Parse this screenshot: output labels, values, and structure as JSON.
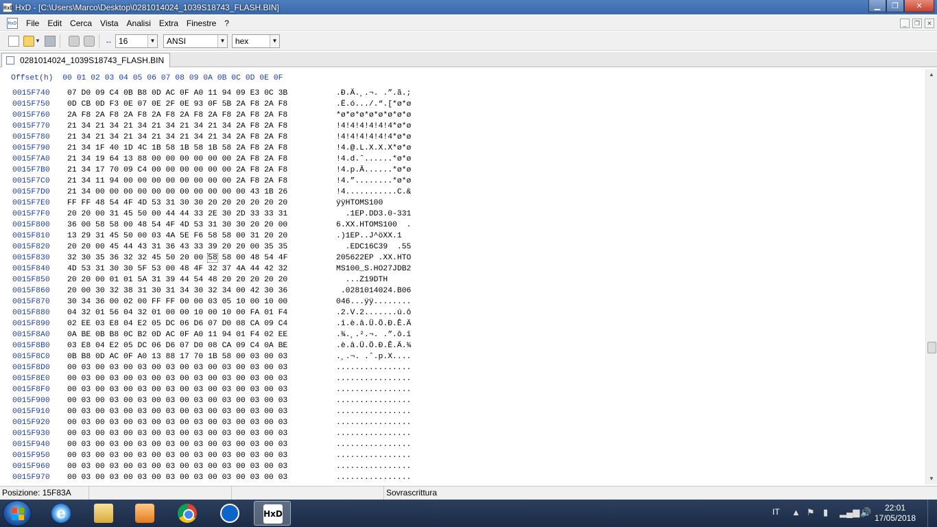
{
  "window": {
    "title": "HxD - [C:\\Users\\Marco\\Desktop\\0281014024_1039S18743_FLASH.BIN]",
    "app_icon_text": "HxD"
  },
  "window_controls": {
    "minimize": "▁",
    "maximize": "❐",
    "close": "✕"
  },
  "menu": [
    "File",
    "Edit",
    "Cerca",
    "Vista",
    "Analisi",
    "Extra",
    "Finestre",
    "?"
  ],
  "toolbar": {
    "bytes_per_row": "16",
    "charset": "ANSI",
    "offset_base": "hex"
  },
  "tab": {
    "label": "0281014024_1039S18743_FLASH.BIN"
  },
  "editor": {
    "header": "Offset(h)  00 01 02 03 04 05 06 07 08 09 0A 0B 0C 0D 0E 0F",
    "rows": [
      {
        "off": "0015F740",
        "hex": "07 D0 09 C4 0B B8 0D AC 0F A0 11 94 09 E3 0C 3B",
        "asc": ".Ð.Ä.¸.¬. .”.ã.;"
      },
      {
        "off": "0015F750",
        "hex": "0D CB 0D F3 0E 07 0E 2F 0E 93 0F 5B 2A F8 2A F8",
        "asc": ".Ë.ó.../.“.[*ø*ø"
      },
      {
        "off": "0015F760",
        "hex": "2A F8 2A F8 2A F8 2A F8 2A F8 2A F8 2A F8 2A F8",
        "asc": "*ø*ø*ø*ø*ø*ø*ø*ø"
      },
      {
        "off": "0015F770",
        "hex": "21 34 21 34 21 34 21 34 21 34 21 34 2A F8 2A F8",
        "asc": "!4!4!4!4!4!4*ø*ø"
      },
      {
        "off": "0015F780",
        "hex": "21 34 21 34 21 34 21 34 21 34 21 34 2A F8 2A F8",
        "asc": "!4!4!4!4!4!4*ø*ø"
      },
      {
        "off": "0015F790",
        "hex": "21 34 1F 40 1D 4C 1B 58 1B 58 1B 58 2A F8 2A F8",
        "asc": "!4.@.L.X.X.X*ø*ø"
      },
      {
        "off": "0015F7A0",
        "hex": "21 34 19 64 13 88 00 00 00 00 00 00 2A F8 2A F8",
        "asc": "!4.d.ˆ......*ø*ø"
      },
      {
        "off": "0015F7B0",
        "hex": "21 34 17 70 09 C4 00 00 00 00 00 00 2A F8 2A F8",
        "asc": "!4.p.Ä......*ø*ø"
      },
      {
        "off": "0015F7C0",
        "hex": "21 34 11 94 00 00 00 00 00 00 00 00 2A F8 2A F8",
        "asc": "!4.”........*ø*ø"
      },
      {
        "off": "0015F7D0",
        "hex": "21 34 00 00 00 00 00 00 00 00 00 00 00 43 1B 26",
        "asc": "!4...........C.&"
      },
      {
        "off": "0015F7E0",
        "hex": "FF FF 48 54 4F 4D 53 31 30 30 20 20 20 20 20 20",
        "asc": "ÿÿHTOMS100      "
      },
      {
        "off": "0015F7F0",
        "hex": "20 20 00 31 45 50 00 44 44 33 2E 30 2D 33 33 31",
        "asc": "  .1EP.DD3.0-331"
      },
      {
        "off": "0015F800",
        "hex": "36 00 58 58 00 48 54 4F 4D 53 31 30 30 20 20 00",
        "asc": "6.XX.HTOMS100  ."
      },
      {
        "off": "0015F810",
        "hex": "13 29 31 45 50 00 03 4A 5E F6 58 58 00 31 20 20",
        "asc": ".)1EP..J^öXX.1  "
      },
      {
        "off": "0015F820",
        "hex": "20 20 00 45 44 43 31 36 43 33 39 20 20 00 35 35",
        "asc": "  .EDC16C39  .55"
      },
      {
        "off": "0015F830",
        "hex": "32 30 35 36 32 32 45 50 20 00 58 58 00 48 54 4F",
        "asc": "205622EP .XX.HTO"
      },
      {
        "off": "0015F840",
        "hex": "4D 53 31 30 30 5F 53 00 48 4F 32 37 4A 44 42 32",
        "asc": "MS100_S.HO27JDB2"
      },
      {
        "off": "0015F850",
        "hex": "20 20 00 01 01 5A 31 39 44 54 48 20 20 20 20 20",
        "asc": "  ...Z19DTH     "
      },
      {
        "off": "0015F860",
        "hex": "20 00 30 32 38 31 30 31 34 30 32 34 00 42 30 36",
        "asc": " .0281014024.B06"
      },
      {
        "off": "0015F870",
        "hex": "30 34 36 00 02 00 FF FF 00 00 03 05 10 00 10 00",
        "asc": "046...ÿÿ........"
      },
      {
        "off": "0015F880",
        "hex": "04 32 01 56 04 32 01 00 00 10 00 10 00 FA 01 F4",
        "asc": ".2.V.2.......ú.ô"
      },
      {
        "off": "0015F890",
        "hex": "02 EE 03 E8 04 E2 05 DC 06 D6 07 D0 08 CA 09 C4",
        "asc": ".î.è.â.Ü.Ö.Ð.Ê.Ä"
      },
      {
        "off": "0015F8A0",
        "hex": "0A BE 0B B8 0C B2 0D AC 0F A0 11 94 01 F4 02 EE",
        "asc": ".¾.¸.².¬. .”.ô.î"
      },
      {
        "off": "0015F8B0",
        "hex": "03 E8 04 E2 05 DC 06 D6 07 D0 08 CA 09 C4 0A BE",
        "asc": ".è.â.Ü.Ö.Ð.Ê.Ä.¾"
      },
      {
        "off": "0015F8C0",
        "hex": "0B B8 0D AC 0F A0 13 88 17 70 1B 58 00 03 00 03",
        "asc": ".¸.¬. .ˆ.p.X...."
      },
      {
        "off": "0015F8D0",
        "hex": "00 03 00 03 00 03 00 03 00 03 00 03 00 03 00 03",
        "asc": "................"
      },
      {
        "off": "0015F8E0",
        "hex": "00 03 00 03 00 03 00 03 00 03 00 03 00 03 00 03",
        "asc": "................"
      },
      {
        "off": "0015F8F0",
        "hex": "00 03 00 03 00 03 00 03 00 03 00 03 00 03 00 03",
        "asc": "................"
      },
      {
        "off": "0015F900",
        "hex": "00 03 00 03 00 03 00 03 00 03 00 03 00 03 00 03",
        "asc": "................"
      },
      {
        "off": "0015F910",
        "hex": "00 03 00 03 00 03 00 03 00 03 00 03 00 03 00 03",
        "asc": "................"
      },
      {
        "off": "0015F920",
        "hex": "00 03 00 03 00 03 00 03 00 03 00 03 00 03 00 03",
        "asc": "................"
      },
      {
        "off": "0015F930",
        "hex": "00 03 00 03 00 03 00 03 00 03 00 03 00 03 00 03",
        "asc": "................"
      },
      {
        "off": "0015F940",
        "hex": "00 03 00 03 00 03 00 03 00 03 00 03 00 03 00 03",
        "asc": "................"
      },
      {
        "off": "0015F950",
        "hex": "00 03 00 03 00 03 00 03 00 03 00 03 00 03 00 03",
        "asc": "................"
      },
      {
        "off": "0015F960",
        "hex": "00 03 00 03 00 03 00 03 00 03 00 03 00 03 00 03",
        "asc": "................"
      },
      {
        "off": "0015F970",
        "hex": "00 03 00 03 00 03 00 03 00 03 00 03 00 03 00 03",
        "asc": "................"
      }
    ],
    "cursor": {
      "row": 15,
      "byte": 10
    }
  },
  "status": {
    "position": "Posizione: 15F83A",
    "mode": "Sovrascrittura"
  },
  "taskbar": {
    "lang": "IT",
    "time": "22:01",
    "date": "17/05/2018",
    "apps": [
      "internet-explorer",
      "file-explorer",
      "media-player",
      "chrome",
      "teamviewer",
      "hxd"
    ],
    "hxd_label": "HxD"
  },
  "colors": {
    "offset_blue": "#1c3fa8",
    "title_blue": "#3a68ad"
  }
}
